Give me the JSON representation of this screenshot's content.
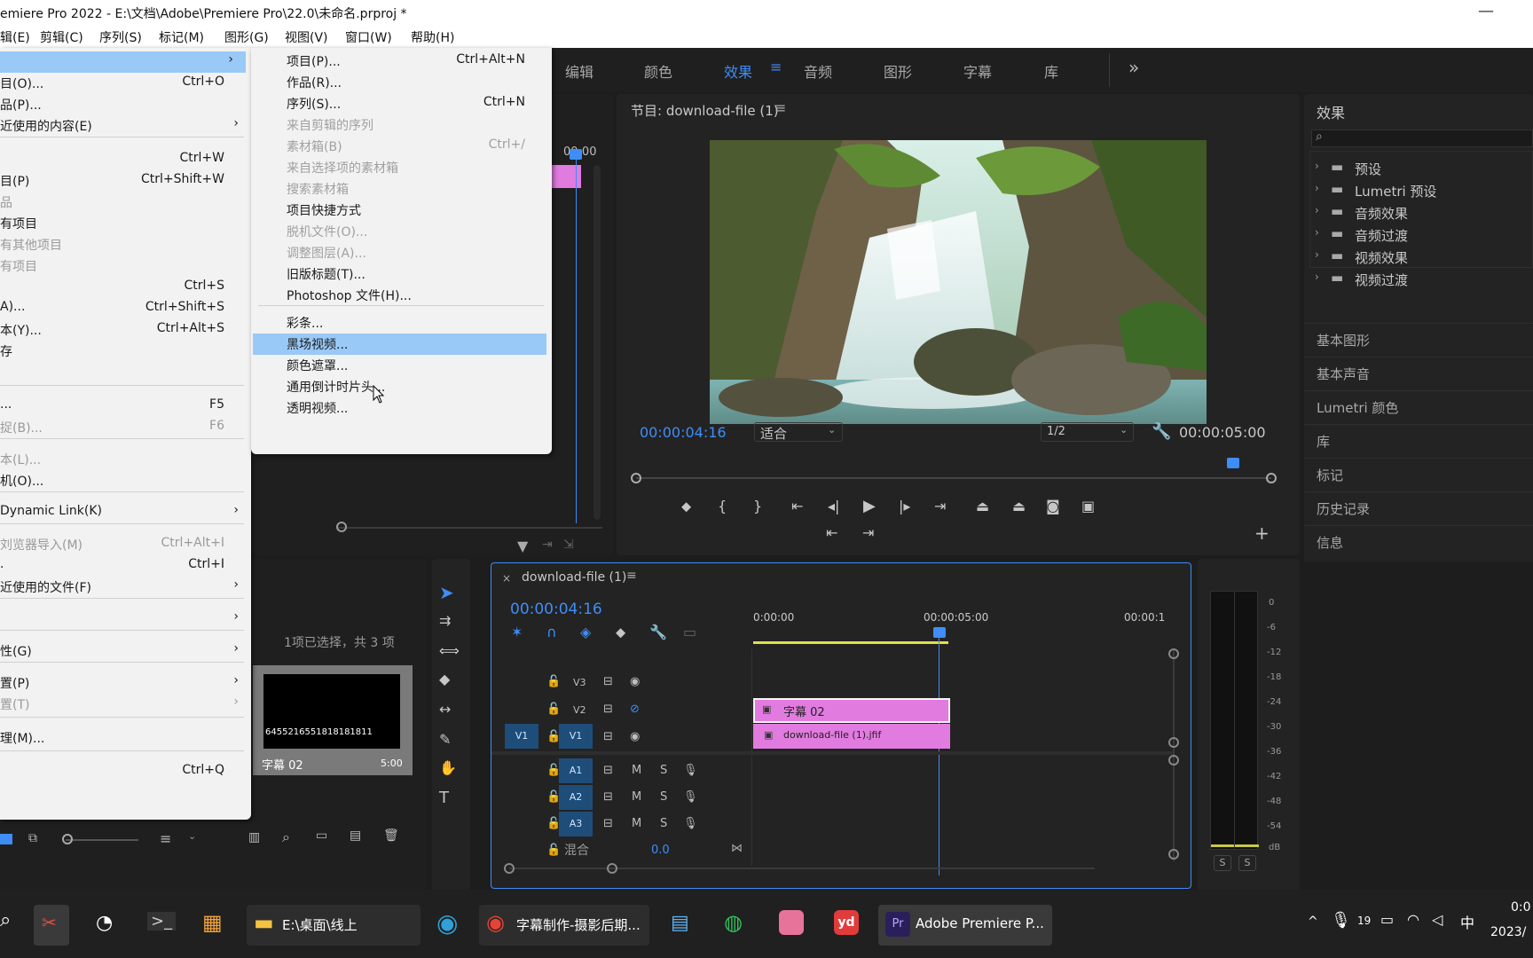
{
  "window": {
    "title": "emiere Pro 2022 - E:\\文档\\Adobe\\Premiere Pro\\22.0\\未命名.prproj *",
    "minimize": "—"
  },
  "menubar": [
    "辑(E)",
    "剪辑(C)",
    "序列(S)",
    "标记(M)",
    "图形(G)",
    "视图(V)",
    "窗口(W)",
    "帮助(H)"
  ],
  "workspace_tabs": [
    "编辑",
    "颜色",
    "效果",
    "音频",
    "图形",
    "字幕",
    "库"
  ],
  "workspace_more": "»",
  "file_menu": [
    {
      "label": "",
      "shortcut": "",
      "arrow": "›",
      "highlight": true
    },
    {
      "label": "目(O)...",
      "shortcut": "Ctrl+O"
    },
    {
      "label": "品(P)...",
      "shortcut": ""
    },
    {
      "label": "近使用的内容(E)",
      "shortcut": "",
      "arrow": "›"
    },
    {
      "label": "",
      "shortcut": "Ctrl+W",
      "sep_before": true
    },
    {
      "label": "目(P)",
      "shortcut": "Ctrl+Shift+W"
    },
    {
      "label": "品",
      "shortcut": "",
      "disabled": true
    },
    {
      "label": "有项目",
      "shortcut": ""
    },
    {
      "label": "有其他项目",
      "shortcut": "",
      "disabled": true
    },
    {
      "label": "有项目",
      "shortcut": "",
      "disabled": true
    },
    {
      "label": "",
      "shortcut": "Ctrl+S"
    },
    {
      "label": "A)...",
      "shortcut": "Ctrl+Shift+S"
    },
    {
      "label": "本(Y)...",
      "shortcut": "Ctrl+Alt+S"
    },
    {
      "label": "存",
      "shortcut": ""
    },
    {
      "label": "",
      "shortcut": ""
    },
    {
      "label": "...",
      "shortcut": "F5",
      "sep_before": true
    },
    {
      "label": "捉(B)...",
      "shortcut": "F6",
      "disabled": true
    },
    {
      "label": "本(L)...",
      "shortcut": "",
      "disabled": true,
      "sep_before": true
    },
    {
      "label": "机(O)...",
      "shortcut": ""
    },
    {
      "label": "Dynamic Link(K)",
      "shortcut": "",
      "arrow": "›",
      "sep_before": true
    },
    {
      "label": "刘览器导入(M)",
      "shortcut": "Ctrl+Alt+I",
      "disabled": true,
      "sep_before": true
    },
    {
      "label": ".",
      "shortcut": "Ctrl+I"
    },
    {
      "label": "近使用的文件(F)",
      "shortcut": "",
      "arrow": "›"
    },
    {
      "label": "",
      "shortcut": "",
      "arrow": "›",
      "sep_before": true
    },
    {
      "label": "性(G)",
      "shortcut": "",
      "arrow": "›",
      "sep_before": true
    },
    {
      "label": "置(P)",
      "shortcut": "",
      "arrow": "›",
      "sep_before": true
    },
    {
      "label": "置(T)",
      "shortcut": "",
      "arrow": "›",
      "disabled": true
    },
    {
      "label": "理(M)...",
      "shortcut": "",
      "sep_before": true
    },
    {
      "label": "",
      "shortcut": "Ctrl+Q",
      "sep_before": true
    }
  ],
  "new_submenu": [
    {
      "label": "项目(P)...",
      "shortcut": "Ctrl+Alt+N"
    },
    {
      "label": "作品(R)...",
      "shortcut": ""
    },
    {
      "label": "序列(S)...",
      "shortcut": "Ctrl+N"
    },
    {
      "label": "来自剪辑的序列",
      "shortcut": "",
      "disabled": true
    },
    {
      "label": "素材箱(B)",
      "shortcut": "Ctrl+/",
      "disabled": true
    },
    {
      "label": "来自选择项的素材箱",
      "shortcut": "",
      "disabled": true
    },
    {
      "label": "搜索素材箱",
      "shortcut": "",
      "disabled": true
    },
    {
      "label": "项目快捷方式",
      "shortcut": ""
    },
    {
      "label": "脱机文件(O)...",
      "shortcut": "",
      "disabled": true
    },
    {
      "label": "调整图层(A)...",
      "shortcut": "",
      "disabled": true
    },
    {
      "label": "旧版标题(T)...",
      "shortcut": ""
    },
    {
      "label": "Photoshop 文件(H)...",
      "shortcut": ""
    },
    {
      "label": "彩条...",
      "shortcut": "",
      "sep_before": true
    },
    {
      "label": "黑场视频...",
      "shortcut": "",
      "highlight": true
    },
    {
      "label": "颜色遮罩...",
      "shortcut": ""
    },
    {
      "label": "通用倒计时片头...",
      "shortcut": ""
    },
    {
      "label": "透明视频...",
      "shortcut": ""
    }
  ],
  "source_panel": {
    "timecode": "00:00"
  },
  "program_monitor": {
    "title": "节目: download-file (1)",
    "timecode": "00:00:04:16",
    "fit": "适合",
    "resolution": "1/2",
    "duration": "00:00:05:00"
  },
  "effects_panel": {
    "title": "效果",
    "search_icon": "⌕",
    "items": [
      "预设",
      "Lumetri 预设",
      "音频效果",
      "音频过渡",
      "视频效果",
      "视频过渡"
    ]
  },
  "side_panels": [
    "基本图形",
    "基本声音",
    "Lumetri 颜色",
    "库",
    "标记",
    "历史记录",
    "信息"
  ],
  "project_panel": {
    "selection_info": "1项已选择，共 3 项",
    "thumb_text": "6455216551818181811",
    "clip_name": "字幕 02",
    "clip_duration": "5:00"
  },
  "timeline": {
    "tab": "download-file (1)",
    "timecode": "00:00:04:16",
    "ruler": [
      "0:00:00",
      "00:00:05:00",
      "00:00:1"
    ],
    "video_tracks": [
      "V3",
      "V2",
      "V1"
    ],
    "audio_tracks": [
      "A1",
      "A2",
      "A3"
    ],
    "source_patch": "V1",
    "mix_label": "混合",
    "mix_value": "0.0",
    "track_m": "M",
    "track_s": "S",
    "clips": [
      {
        "name": "字幕 02",
        "track": "V2",
        "color": "#e27be0"
      },
      {
        "name": "download-file (1).jfif",
        "track": "V1",
        "color": "#e27be0"
      }
    ]
  },
  "meter": {
    "scale": [
      "0",
      "-6",
      "-12",
      "-18",
      "-24",
      "-30",
      "-36",
      "-42",
      "-48",
      "-54",
      "dB"
    ],
    "solo": [
      "S",
      "S"
    ]
  },
  "taskbar": {
    "explorer": "E:\\桌面\\线上",
    "chrome": "字幕制作-摄影后期...",
    "premiere": "Adobe Premiere P...",
    "tray_num": "19",
    "ime": "中",
    "time": "0:0",
    "date": "2023/"
  },
  "colors": {
    "accent": "#3f8df7",
    "clip": "#e27be0",
    "highlight": "#99c9f7",
    "track_label": "#1e4d7a"
  }
}
